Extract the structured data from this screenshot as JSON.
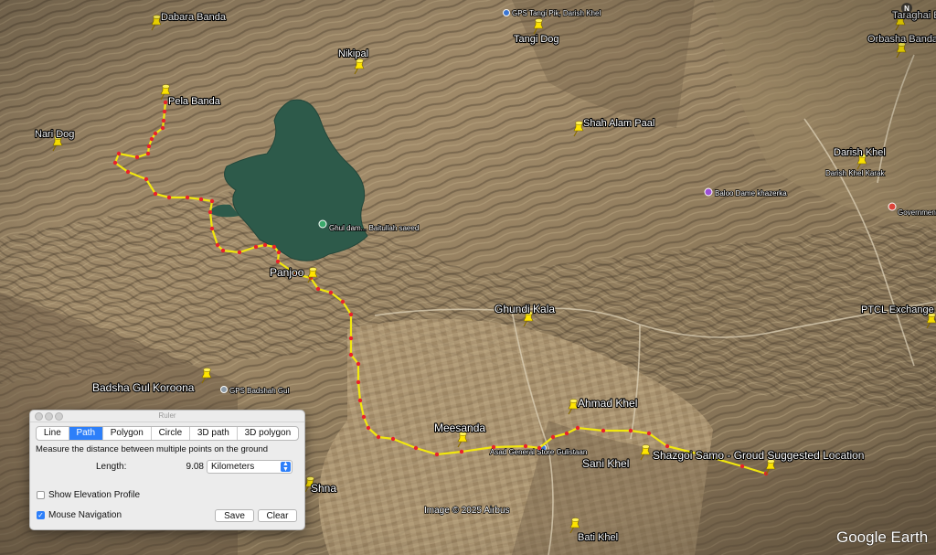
{
  "map": {
    "attribution": "Image © 2025 Airbus",
    "brand": "Google Earth",
    "compass": "N",
    "path_color": "#f2e70e",
    "vertex_color": "#e8222a"
  },
  "places": [
    {
      "label": "Dabara Banda"
    },
    {
      "label": "Tangi Dog"
    },
    {
      "label": "Taraghai B"
    },
    {
      "label": "Orbasha Banda"
    },
    {
      "label": "Nikipal"
    },
    {
      "label": "Pela Banda"
    },
    {
      "label": "Nari Dog"
    },
    {
      "label": "Shah Alam Paal"
    },
    {
      "label": "Darish Khel"
    },
    {
      "label": "Panjoo"
    },
    {
      "label": "Ghundi Kala"
    },
    {
      "label": "PTCL Exchange"
    },
    {
      "label": "Badsha Gul Koroona"
    },
    {
      "label": "Ahmad Khel"
    },
    {
      "label": "Meesanda"
    },
    {
      "label": "Sani Khel"
    },
    {
      "label": "Shazgoi Samo - Groud Suggested Location"
    },
    {
      "label": "Shna"
    },
    {
      "label": "Bati Khel"
    }
  ],
  "pois": [
    {
      "label": "GPS Tangi Pik, Darish Khel"
    },
    {
      "label": "Darish Khel Karak"
    },
    {
      "label": "Baloo Dame khazerka"
    },
    {
      "label": "Government"
    },
    {
      "label": "Ghul dam... Baitullah saeed"
    },
    {
      "label": "GPS Badshah Gul"
    },
    {
      "label": "Asad General Store Gulistaan"
    }
  ],
  "ruler": {
    "window_title": "Ruler",
    "tabs": [
      "Line",
      "Path",
      "Polygon",
      "Circle",
      "3D path",
      "3D polygon"
    ],
    "active_tab": "Path",
    "description": "Measure the distance between multiple points on the ground",
    "length_label": "Length:",
    "length_value": "9.08",
    "unit": "Kilometers",
    "elevation_label": "Show Elevation Profile",
    "elevation_checked": false,
    "mouse_nav_label": "Mouse Navigation",
    "mouse_nav_checked": true,
    "save_label": "Save",
    "clear_label": "Clear"
  }
}
